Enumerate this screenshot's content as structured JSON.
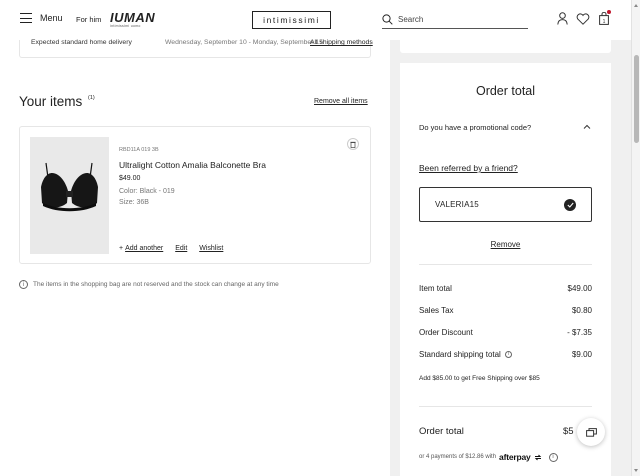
{
  "header": {
    "menu_label": "Menu",
    "for_him": "For him",
    "sub_brand": "IUMAN",
    "sub_brand_tagline": "intimissimi uomo",
    "logo_text": "intimissimi",
    "search_placeholder": "Search"
  },
  "delivery": {
    "label": "Expected standard home delivery",
    "dates": "Wednesday, September 10 - Monday, September 15",
    "link": "All shipping methods"
  },
  "items_section": {
    "title": "Your items",
    "count": "(1)",
    "remove_all": "Remove all items"
  },
  "item": {
    "sku": "RBD11A 019 3B",
    "name": "Ultralight Cotton Amalia Balconette Bra",
    "price": "$49.00",
    "color": "Color: Black - 019",
    "size": "Size: 36B",
    "add_another": "Add another",
    "edit": "Edit",
    "wishlist": "Wishlist"
  },
  "stock_note": "The items in the shopping bag are not reserved and the stock can change at any time",
  "order": {
    "title": "Order total",
    "promo_question": "Do you have a promotional code?",
    "referred": "Been referred by a friend?",
    "promo_code": "VALERIA15",
    "remove": "Remove",
    "rows": [
      {
        "label": "Item total",
        "value": "$49.00"
      },
      {
        "label": "Sales Tax",
        "value": "$0.80"
      },
      {
        "label": "Order Discount",
        "value": "- $7.35"
      },
      {
        "label": "Standard shipping total",
        "value": "$9.00"
      }
    ],
    "free_shipping_note": "Add $85.00 to get Free Shipping over $85",
    "total_label": "Order total",
    "total_value": "$5",
    "afterpay_text": "or 4 payments of $12.86 with",
    "afterpay_brand": "afterpay"
  },
  "colors": {
    "accent_dot": "#c0182e",
    "text": "#222222",
    "panel_bg": "#f0f0f0"
  }
}
